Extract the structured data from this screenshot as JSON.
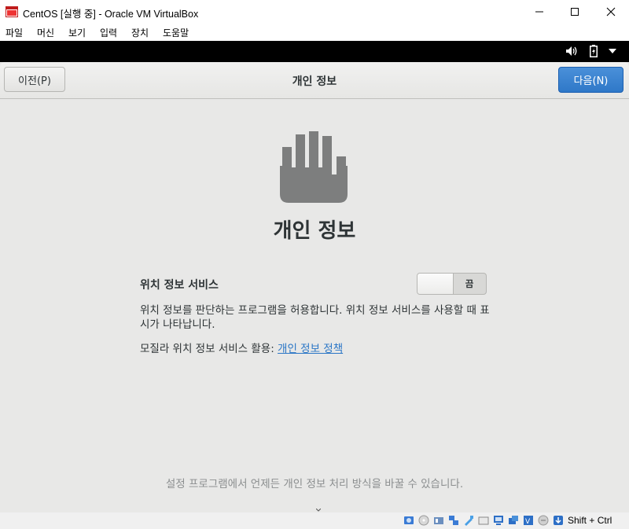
{
  "window": {
    "title": "CentOS [실행 중] - Oracle VM VirtualBox",
    "controls": [
      "minimize-icon",
      "maximize-icon",
      "close-icon"
    ]
  },
  "menubar": {
    "items": [
      {
        "label": "파일"
      },
      {
        "label": "머신"
      },
      {
        "label": "보기"
      },
      {
        "label": "입력"
      },
      {
        "label": "장치"
      },
      {
        "label": "도움말"
      }
    ]
  },
  "guest_topbar": {
    "icons": [
      "volume-icon",
      "battery-icon",
      "system-menu-arrow-icon"
    ]
  },
  "header": {
    "prev_label": "이전(P)",
    "title": "개인 정보",
    "next_label": "다음(N)"
  },
  "main": {
    "icon": "privacy-hand-icon",
    "heading": "개인 정보",
    "location_label": "위치 정보 서비스",
    "toggle_state": "끔",
    "description": "위치 정보를 판단하는 프로그램을 허용합니다. 위치 정보 서비스를 사용할 때 표시가 나타납니다.",
    "mozilla_prefix": "모질라 위치 정보 서비스 활용: ",
    "mozilla_link": "개인 정보 정책",
    "footer": "설정 프로그램에서 언제든 개인 정보 처리 방식을 바꿀 수 있습니다."
  },
  "statusbar": {
    "host_key": "Shift + Ctrl",
    "icons": [
      "hard-disk-icon",
      "optical-disk-icon",
      "audio-icon",
      "network-icon",
      "usb-icon",
      "shared-folders-icon",
      "display-icon",
      "video-capture-icon",
      "virtualization-icon",
      "mouse-integration-icon",
      "keyboard-capture-icon"
    ]
  },
  "colors": {
    "accent": "#3584e4",
    "link": "#2a76c6",
    "guest_background": "#e8e8e7"
  }
}
